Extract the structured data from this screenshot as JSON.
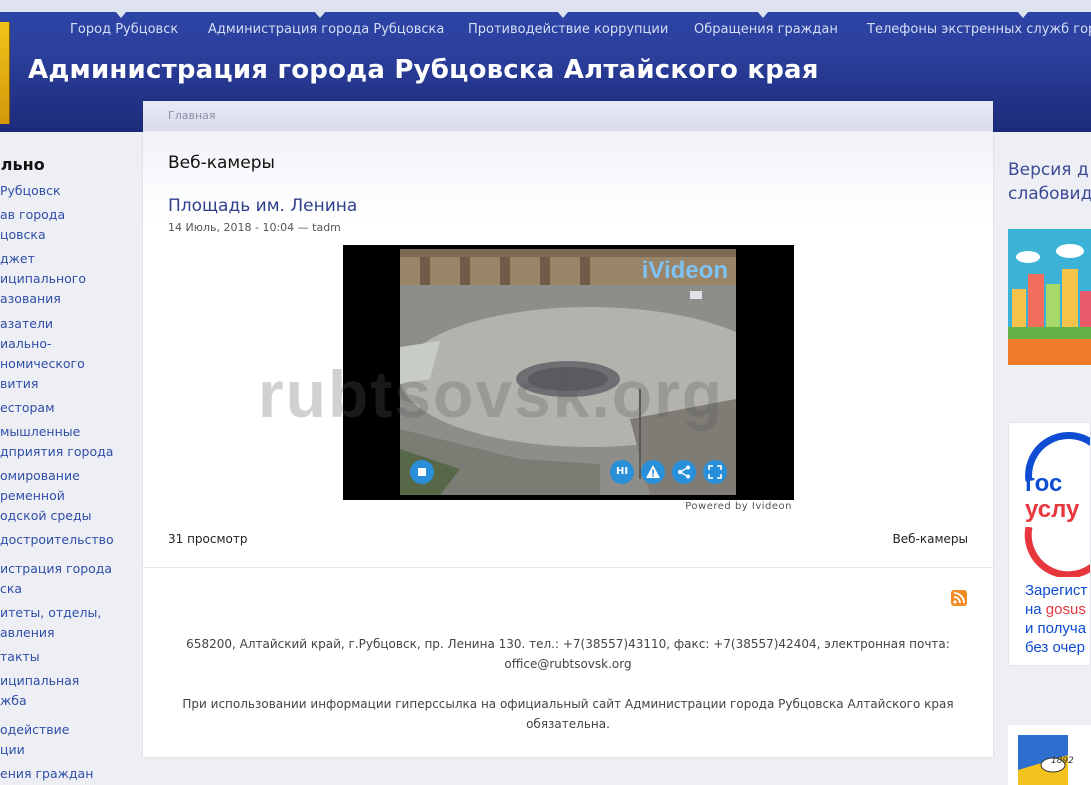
{
  "topnav": {
    "items": [
      "Город Рубцовск",
      "Администрация города Рубцовска",
      "Противодействие коррупции",
      "Обращения граждан",
      "Телефоны экстренных служб горо"
    ]
  },
  "header": {
    "site_title": "Администрация города Рубцовска Алтайского края"
  },
  "breadcrumb": "Главная",
  "sidebar_left": {
    "heading": "ально",
    "items": [
      "Рубцовск",
      "ав города",
      "цовска",
      "джет",
      "иципального",
      "азования",
      "азатели",
      "иально-",
      "номического",
      "вития",
      "есторам",
      "мышленные",
      "дприятия города",
      "омирование",
      "ременной",
      "одской среды",
      "достроительство",
      "истрация города",
      "ска",
      "итеты, отделы,",
      "авления",
      "такты",
      "иципальная",
      "жба",
      "одействие",
      "ции",
      "ения граждан"
    ]
  },
  "main": {
    "page_title": "Веб-камеры",
    "article_title": "Площадь им. Ленина",
    "article_meta": "14 Июль, 2018 - 10:04 — tadm",
    "player": {
      "logo_text": "iVideon",
      "hi_label": "HI",
      "powered_by": "Powered by Ivideon"
    },
    "watermark": "rubtsovsk.org",
    "views": "31 просмотр",
    "category": "Веб-камеры"
  },
  "footer": {
    "address": "658200, Алтайский край, г.Рубцовск, пр. Ленина 130. тел.: +7(38557)43110, факс: +7(38557)42404, электронная почта:",
    "email": "office@rubtsovsk.org",
    "notice": "При использовании информации гиперссылка на официальный сайт Администрации города Рубцовска Алтайского края обязательна."
  },
  "sidebar_right": {
    "version_line1": "Версия д",
    "version_line2": "слабовид",
    "gosuslugi_title1": "гос",
    "gosuslugi_title2": "услу",
    "gosuslugi_text1": "Зарегист",
    "gosuslugi_text2_prefix": "на ",
    "gosuslugi_text2_link": "gosus",
    "gosuslugi_text3": "и получа",
    "gosuslugi_text4": "без очер",
    "emblem_year": "1892"
  },
  "colors": {
    "header_blue": "#2b3f9c",
    "link_blue": "#2f4fa8",
    "player_button": "#2a8fd9",
    "rss_orange": "#f08a24",
    "gosuslugi_red": "#e8363d",
    "gosuslugi_blue": "#0d4cd3"
  },
  "icons": [
    "stop-icon",
    "hi-quality-icon",
    "warning-icon",
    "share-icon",
    "fullscreen-icon",
    "rss-icon"
  ]
}
